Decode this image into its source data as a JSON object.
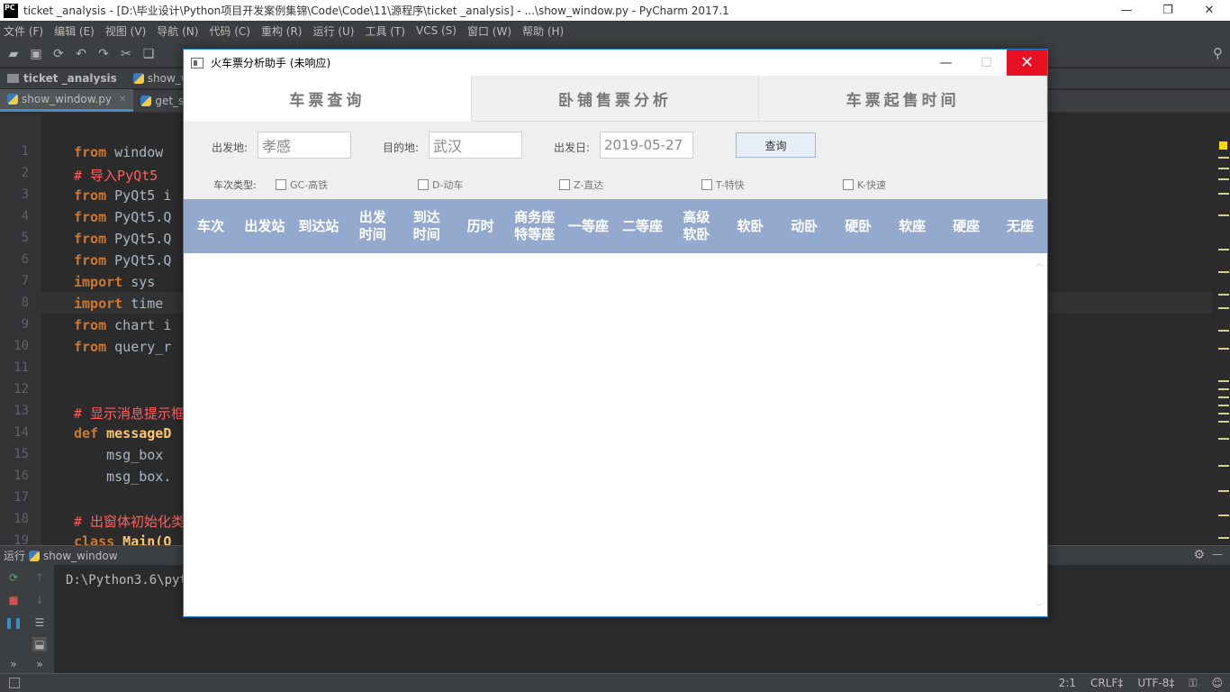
{
  "ide": {
    "window_title": "ticket _analysis - [D:\\毕业设计\\Python项目开发案例集锦\\Code\\Code\\11\\源程序\\ticket _analysis] - ...\\show_window.py - PyCharm 2017.1",
    "logo": "PC",
    "menu": [
      "文件 (F)",
      "编辑 (E)",
      "视图 (V)",
      "导航 (N)",
      "代码 (C)",
      "重构 (R)",
      "运行 (U)",
      "工具 (T)",
      "VCS (S)",
      "窗口 (W)",
      "帮助 (H)"
    ],
    "breadcrumb": {
      "project": "ticket _analysis",
      "file": "show_wir"
    },
    "tabs": [
      {
        "label": "show_window.py",
        "active": true
      },
      {
        "label": "get_s",
        "active": false
      }
    ],
    "line_numbers": [
      "1",
      "2",
      "3",
      "4",
      "5",
      "6",
      "7",
      "8",
      "9",
      "10",
      "11",
      "12",
      "13",
      "14",
      "15",
      "16",
      "17",
      "18",
      "19"
    ],
    "code": {
      "l1_kw": "from",
      "l1_rest": " window",
      "l2": "# 导入PyQt5",
      "l3_kw": "from",
      "l3_rest": " PyQt5 i",
      "l4_kw": "from",
      "l4_rest": " PyQt5.Q",
      "l5_kw": "from",
      "l5_rest": " PyQt5.Q",
      "l6_kw": "from",
      "l6_rest": " PyQt5.Q",
      "l7_kw": "import",
      "l7_rest": " sys",
      "l8_kw": "import",
      "l8_rest": " time",
      "l9_kw": "from",
      "l9_rest": " chart i",
      "l10_kw": "from",
      "l10_rest": " query_r",
      "l13": "# 显示消息提示框",
      "l14_kw": "def",
      "l14_fn": " messageD",
      "l15": "    msg_box",
      "l16": "    msg_box.",
      "l18": "# 出窗体初始化类",
      "l19_kw": "class",
      "l19_rest": " Main(Q"
    },
    "run": {
      "label": "运行",
      "config": "show_window",
      "output": "D:\\Python3.6\\pyt"
    },
    "status": {
      "position": "2:1",
      "line_sep": "CRLF‡",
      "encoding": "UTF-8‡"
    }
  },
  "app": {
    "title": "火车票分析助手 (未响应)",
    "tabs": [
      "车票查询",
      "卧铺售票分析",
      "车票起售时间"
    ],
    "form": {
      "from_label": "出发地:",
      "from_value": "孝感",
      "to_label": "目的地:",
      "to_value": "武汉",
      "date_label": "出发日:",
      "date_value": "2019-05-27",
      "query_button": "查询",
      "type_label": "车次类型:",
      "types": [
        "GC-高铁",
        "D-动车",
        "Z-直达",
        "T-特快",
        "K-快速"
      ]
    },
    "table_headers": [
      {
        "l1": "车次",
        "l2": ""
      },
      {
        "l1": "出发站",
        "l2": ""
      },
      {
        "l1": "到达站",
        "l2": ""
      },
      {
        "l1": "出发",
        "l2": "时间"
      },
      {
        "l1": "到达",
        "l2": "时间"
      },
      {
        "l1": "历时",
        "l2": ""
      },
      {
        "l1": "商务座",
        "l2": "特等座"
      },
      {
        "l1": "一等座",
        "l2": ""
      },
      {
        "l1": "二等座",
        "l2": ""
      },
      {
        "l1": "高级",
        "l2": "软卧"
      },
      {
        "l1": "软卧",
        "l2": ""
      },
      {
        "l1": "动卧",
        "l2": ""
      },
      {
        "l1": "硬卧",
        "l2": ""
      },
      {
        "l1": "软座",
        "l2": ""
      },
      {
        "l1": "硬座",
        "l2": ""
      },
      {
        "l1": "无座",
        "l2": ""
      }
    ],
    "colors": {
      "header_bg": "#93a9ce",
      "close_red": "#e81123"
    }
  }
}
